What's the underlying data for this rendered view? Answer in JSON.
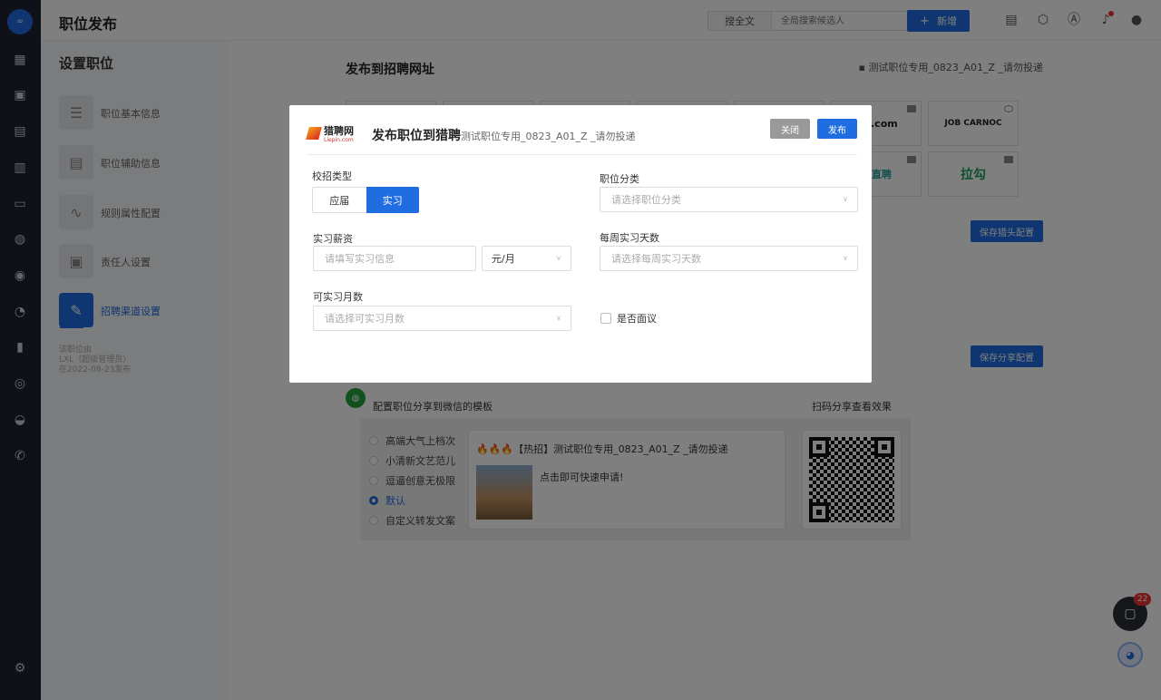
{
  "app": {
    "page_title": "职位发布",
    "logo_text": "∞",
    "search_scope": "搜全文",
    "search_placeholder": "全局搜索候选人",
    "new_button": "新增",
    "new_icon": "plus-icon"
  },
  "side": {
    "title": "设置职位",
    "steps": [
      {
        "label": "职位基本信息"
      },
      {
        "label": "职位辅助信息"
      },
      {
        "label": "规则属性配置"
      },
      {
        "label": "责任人设置"
      },
      {
        "label": "招聘渠道设置"
      }
    ],
    "meta": [
      "该职位由",
      "LXL（超级管理员）",
      "在2022-08-23发布"
    ]
  },
  "main": {
    "title": "发布到招聘网址",
    "job_label": "测试职位专用_0823_A01_Z _请勿投递",
    "sites": [
      "OB.com",
      "JOB CARNOC",
      "S 直聘",
      "拉勾"
    ],
    "save_headhunter": "保存猎头配置",
    "save_share": "保存分享配置",
    "wechat_label": "配置职位分享到微信的模板",
    "scan_label": "扫码分享查看效果",
    "templates": [
      "高端大气上档次",
      "小清新文艺范儿",
      "逗逼创意无极限",
      "默认",
      "自定义转发文案"
    ],
    "selected_template": "默认",
    "preview_title": "🔥🔥🔥【热招】测试职位专用_0823_A01_Z _请勿投递",
    "preview_text": "点击即可快速申请!",
    "chat_badge": "22"
  },
  "modal": {
    "logo_text": "猎聘网",
    "logo_sub": "Liepin.com",
    "title": "发布职位到猎聘",
    "subtitle": "测试职位专用_0823_A01_Z _请勿投递",
    "close_button": "关闭",
    "publish_button": "发布",
    "campus_type_label": "校招类型",
    "campus_options": [
      "应届",
      "实习"
    ],
    "campus_selected": "实习",
    "category_label": "职位分类",
    "category_placeholder": "请选择职位分类",
    "salary_label": "实习薪资",
    "salary_placeholder": "请填写实习信息",
    "salary_unit": "元/月",
    "days_label": "每周实习天数",
    "days_placeholder": "请选择每周实习天数",
    "months_label": "可实习月数",
    "months_placeholder": "请选择可实习月数",
    "negotiable_label": "是否面议",
    "negotiable_checked": false
  },
  "colors": {
    "accent": "#1f6de0",
    "nav_bg": "#1d2531"
  }
}
